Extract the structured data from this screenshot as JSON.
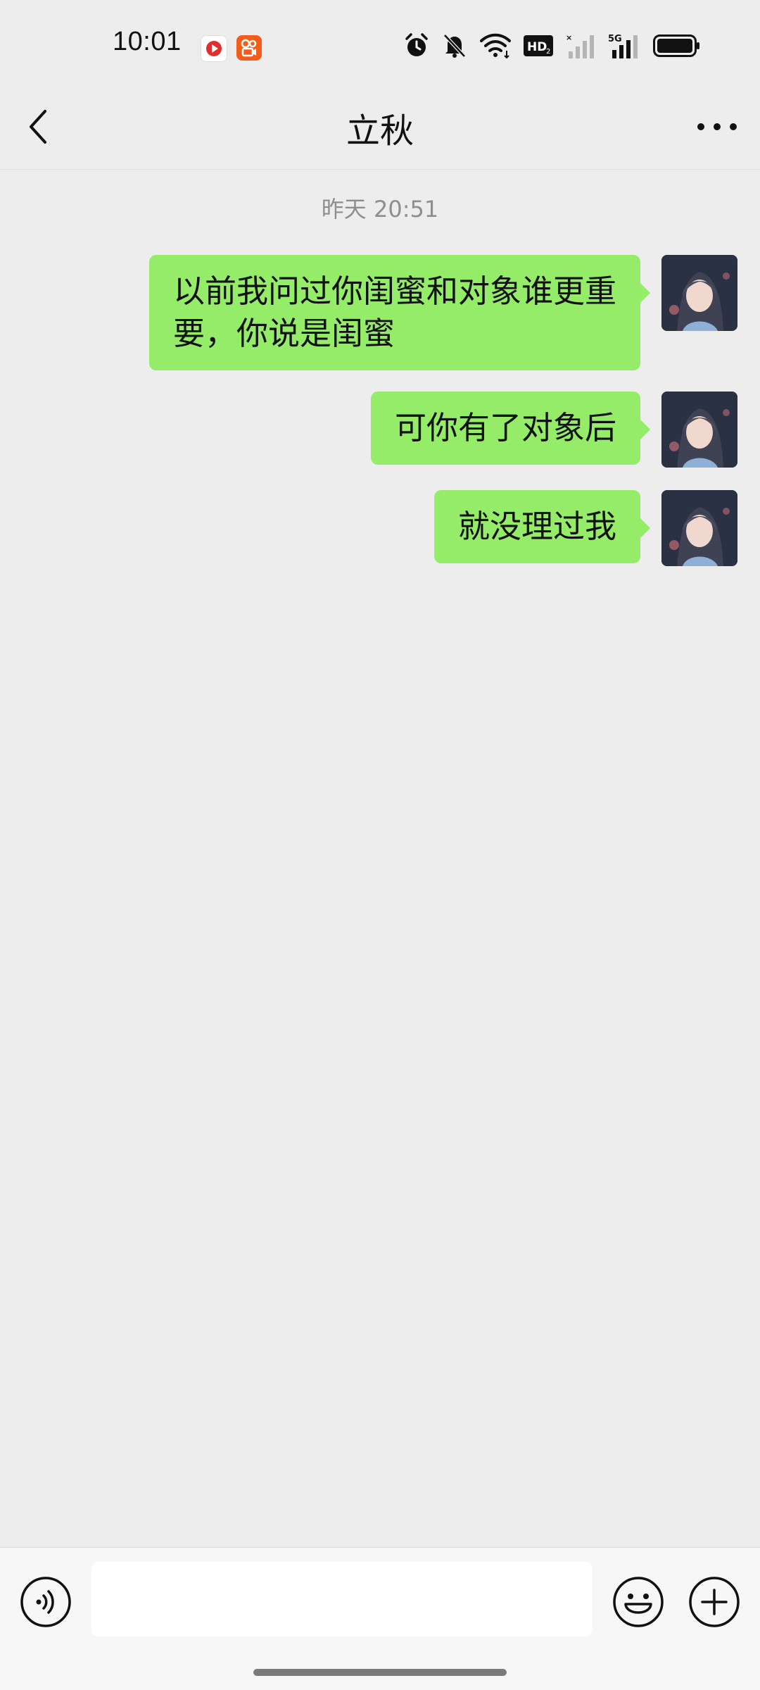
{
  "status_bar": {
    "time": "10:01",
    "icons": [
      "video-app-icon",
      "kuaishou-app-icon",
      "alarm-icon",
      "mute-bell-icon",
      "wifi-icon",
      "hd-icon",
      "signal-icon",
      "signal-5g-icon",
      "battery-icon"
    ],
    "hd_label": "HD2",
    "network_label": "5G"
  },
  "header": {
    "title": "立秋",
    "back_icon": "chevron-left-icon",
    "more_icon": "more-dots-icon"
  },
  "chat": {
    "timestamp": "昨天 20:51",
    "messages": [
      {
        "text_line1": "以前我问过你闺蜜和对象谁更重",
        "text_line2": "要，你说是闺蜜"
      },
      {
        "text": "可你有了对象后"
      },
      {
        "text": "就没理过我"
      }
    ]
  },
  "input_bar": {
    "placeholder": "",
    "value": "",
    "voice_icon": "voice-icon",
    "emoji_icon": "emoji-icon",
    "plus_icon": "plus-icon"
  },
  "colors": {
    "background": "#EDEDED",
    "bubble_green": "#95EC69",
    "timestamp_gray": "#8E8E8E",
    "app_red": "#E02E2E",
    "app_orange": "#F25D1B"
  }
}
